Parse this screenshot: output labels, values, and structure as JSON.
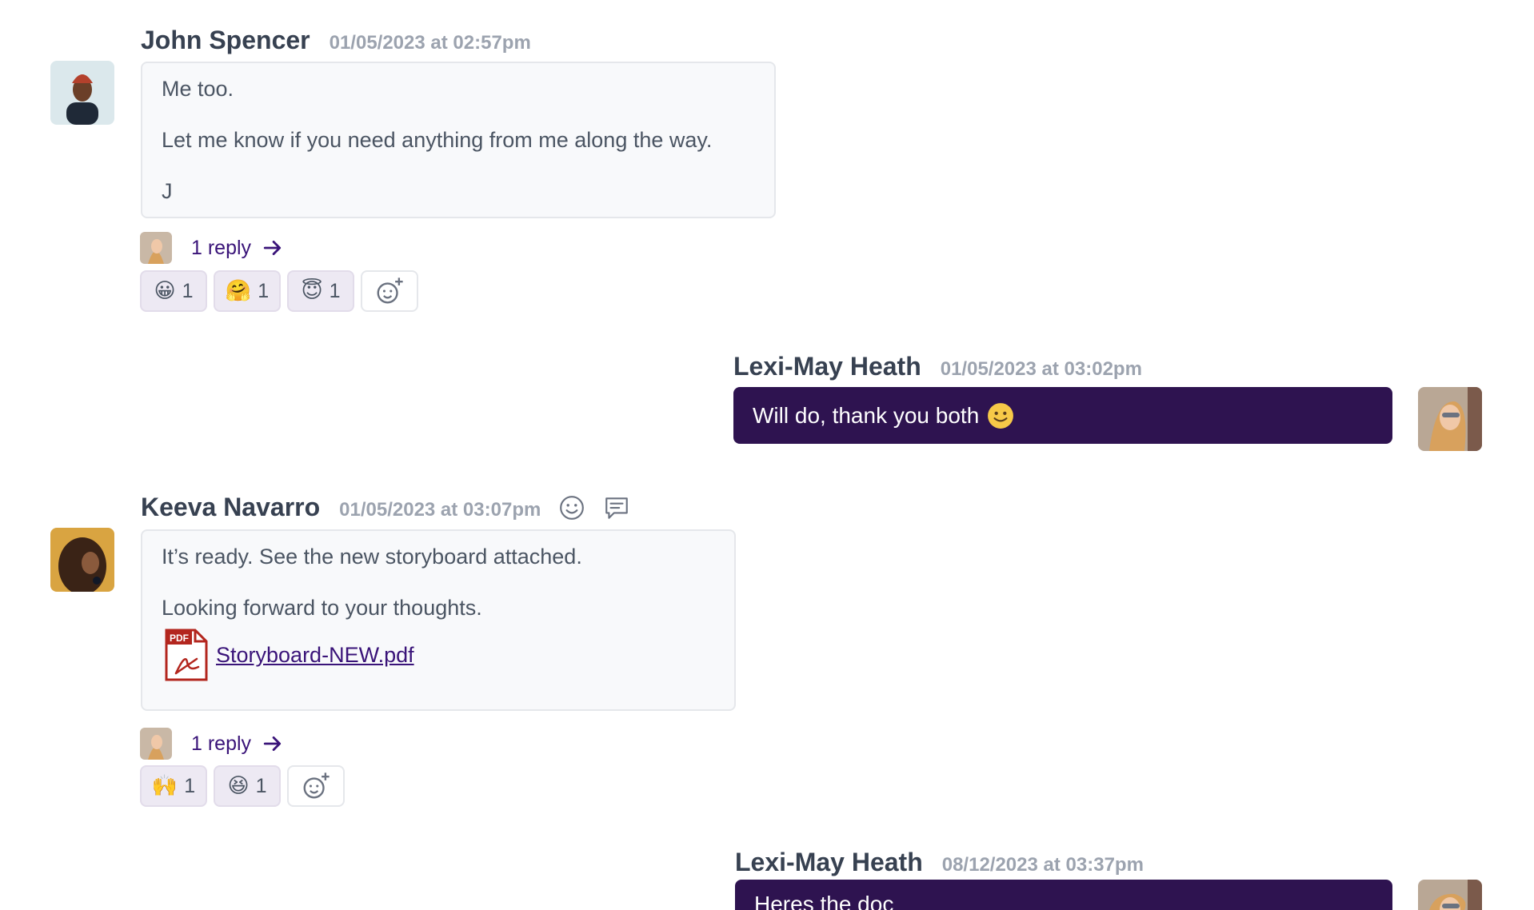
{
  "colors": {
    "accent": "#2e1350",
    "link": "#3a1479",
    "muted": "#9ca3af",
    "bubble_bg": "#f8f9fb"
  },
  "messages": [
    {
      "author": "John Spencer",
      "time": "01/05/2023 at 02:57pm",
      "paragraphs": [
        "Me too.",
        "Let me know if you need anything from me along the way.",
        "J"
      ],
      "reply_label": "1 reply",
      "reactions": [
        {
          "icon": "grinning-face",
          "count": "1"
        },
        {
          "icon": "hugging-face",
          "count": "1"
        },
        {
          "icon": "smiling-face-with-halo",
          "count": "1"
        }
      ]
    },
    {
      "author": "Lexi-May Heath",
      "time": "01/05/2023 at 03:02pm",
      "text": "Will do, thank you both",
      "emoji": "slightly-smiling-face"
    },
    {
      "author": "Keeva Navarro",
      "time": "01/05/2023 at 03:07pm",
      "paragraphs": [
        "It’s ready. See the new storyboard attached.",
        "Looking forward to your thoughts."
      ],
      "attachment": {
        "name": "Storyboard-NEW.pdf",
        "badge": "PDF"
      },
      "reply_label": "1 reply",
      "reactions": [
        {
          "icon": "raising-hands",
          "count": "1"
        },
        {
          "icon": "grinning-squinting-face",
          "count": "1"
        }
      ]
    },
    {
      "author": "Lexi-May Heath",
      "time": "08/12/2023 at 03:37pm",
      "text": "Heres the doc"
    }
  ]
}
